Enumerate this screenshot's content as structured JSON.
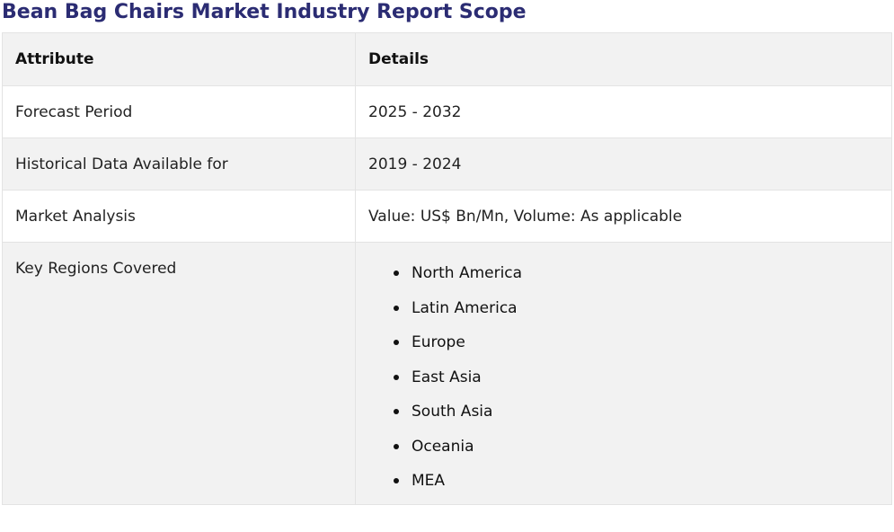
{
  "page": {
    "title": "Bean Bag Chairs Market Industry Report Scope"
  },
  "table": {
    "headers": {
      "attribute": "Attribute",
      "details": "Details"
    },
    "rows": [
      {
        "attribute": "Forecast Period",
        "details": "2025 - 2032"
      },
      {
        "attribute": "Historical Data Available for",
        "details": "2019 - 2024"
      },
      {
        "attribute": "Market Analysis",
        "details": "Value: US$ Bn/Mn, Volume: As applicable"
      }
    ],
    "regions": {
      "attribute": "Key Regions Covered",
      "items": [
        "North America",
        "Latin America",
        "Europe",
        "East Asia",
        "South Asia",
        "Oceania",
        "MEA"
      ]
    }
  },
  "colors": {
    "title": "#2b2c73",
    "header_bg": "#f2f2f2",
    "stripe_bg": "#f2f2f2",
    "border": "#e3e3e3"
  }
}
